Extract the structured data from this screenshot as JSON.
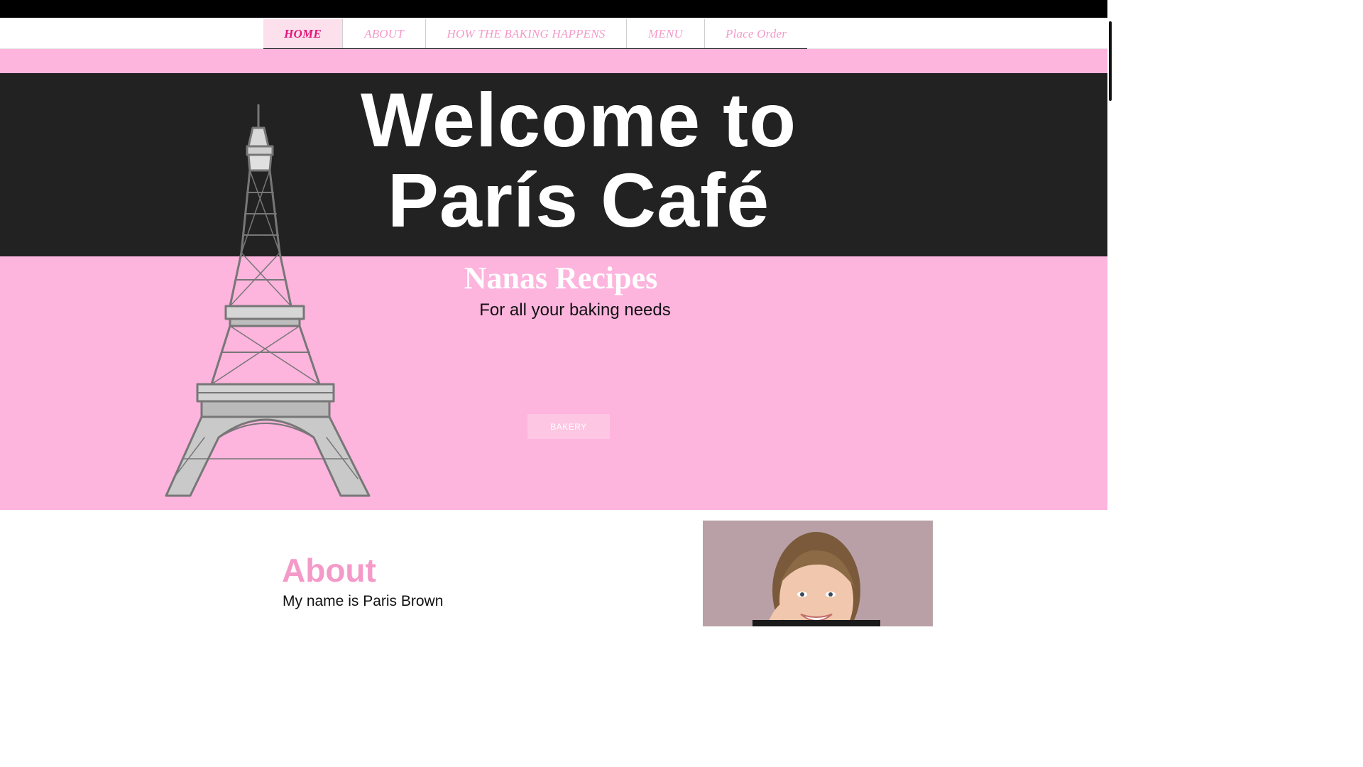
{
  "nav": {
    "items": [
      {
        "label": "HOME",
        "active": true
      },
      {
        "label": "ABOUT",
        "active": false
      },
      {
        "label": "HOW THE BAKING HAPPENS",
        "active": false
      },
      {
        "label": "MENU",
        "active": false
      },
      {
        "label": "Place Order",
        "active": false
      }
    ]
  },
  "hero": {
    "title_line1": "Welcome to",
    "title_line2": "París Café",
    "subtitle": "Nanas Recipes",
    "tagline": "For all your baking needs",
    "cta_label": "BAKERY",
    "illustration_icon": "eiffel-tower-illustration"
  },
  "about": {
    "title": "About",
    "text": "My name is Paris Brown"
  },
  "colors": {
    "pink": "#fdb4dd",
    "dark": "#222222",
    "nav_text": "#f49ac8",
    "nav_active": "#e2187a"
  }
}
